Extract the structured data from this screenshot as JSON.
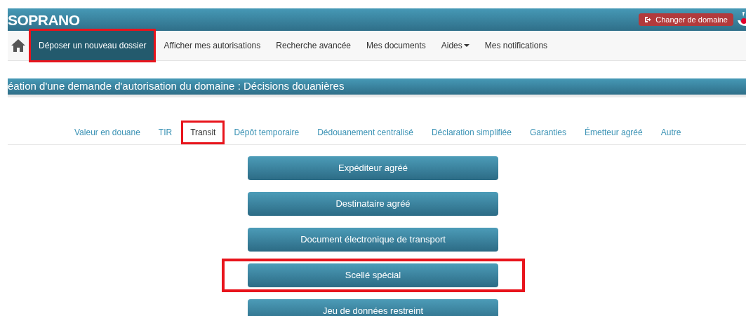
{
  "header": {
    "logo": "SOPRANO",
    "action_button": "Changer de domaine"
  },
  "nav": {
    "items": [
      {
        "label": "Déposer un nouveau dossier",
        "selected": true,
        "highlighted": true,
        "dropdown": false
      },
      {
        "label": "Afficher mes autorisations",
        "selected": false,
        "highlighted": false,
        "dropdown": false
      },
      {
        "label": "Recherche avancée",
        "selected": false,
        "highlighted": false,
        "dropdown": false
      },
      {
        "label": "Mes documents",
        "selected": false,
        "highlighted": false,
        "dropdown": false
      },
      {
        "label": "Aides",
        "selected": false,
        "highlighted": false,
        "dropdown": true
      },
      {
        "label": "Mes notifications",
        "selected": false,
        "highlighted": false,
        "dropdown": false
      }
    ]
  },
  "page_title": "éation d'une demande d'autorisation du domaine : Décisions douanières",
  "tabs": [
    {
      "label": "Valeur en douane",
      "selected": false,
      "highlighted": false
    },
    {
      "label": "TIR",
      "selected": false,
      "highlighted": false
    },
    {
      "label": "Transit",
      "selected": true,
      "highlighted": true
    },
    {
      "label": "Dépôt temporaire",
      "selected": false,
      "highlighted": false
    },
    {
      "label": "Dédouanement centralisé",
      "selected": false,
      "highlighted": false
    },
    {
      "label": "Déclaration simplifiée",
      "selected": false,
      "highlighted": false
    },
    {
      "label": "Garanties",
      "selected": false,
      "highlighted": false
    },
    {
      "label": "Émetteur agréé",
      "selected": false,
      "highlighted": false
    },
    {
      "label": "Autre",
      "selected": false,
      "highlighted": false
    }
  ],
  "options": [
    {
      "label": "Expéditeur agréé",
      "highlighted": false
    },
    {
      "label": "Destinataire agréé",
      "highlighted": false
    },
    {
      "label": "Document électronique de transport",
      "highlighted": false
    },
    {
      "label": "Scellé spécial",
      "highlighted": true
    },
    {
      "label": "Jeu de données restreint",
      "highlighted": false
    }
  ]
}
